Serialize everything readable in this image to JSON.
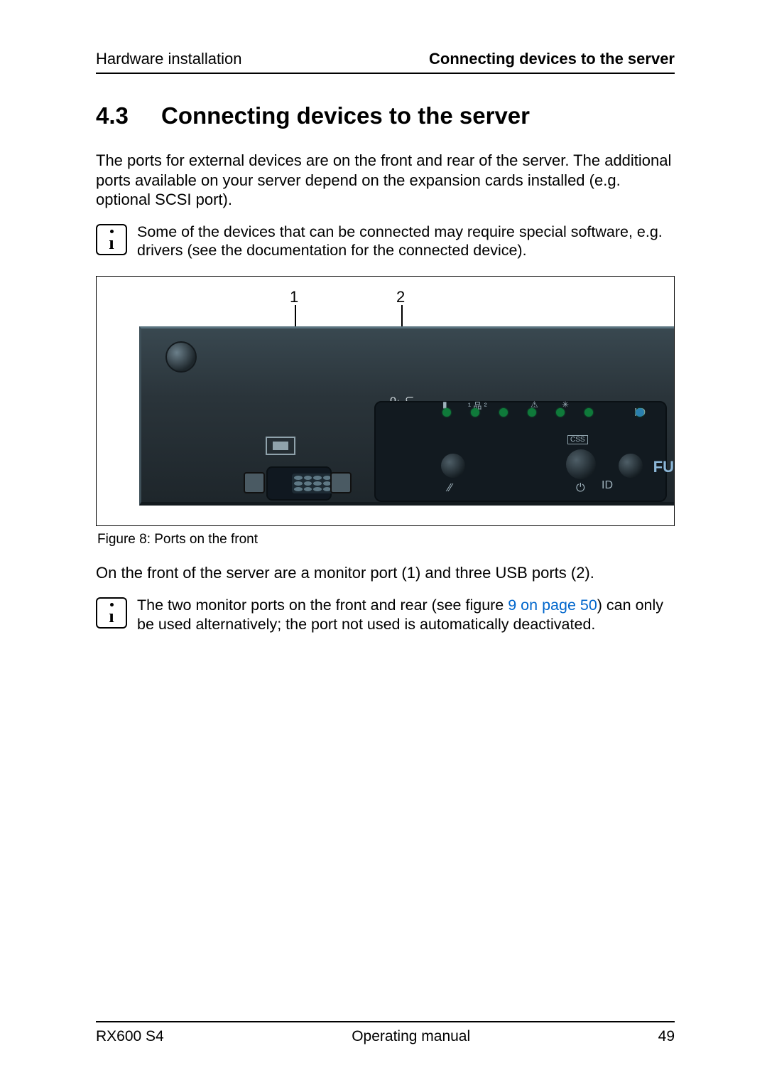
{
  "header": {
    "left": "Hardware installation",
    "right": "Connecting devices to the server"
  },
  "section": {
    "number": "4.3",
    "title": "Connecting devices to the server"
  },
  "p1": "The ports for external devices are on the front and rear of the server. The additional ports available on your server depend on the expansion cards installed (e.g. optional SCSI port).",
  "note1": "Some of the devices that can be connected may require special software, e.g. drivers (see the documentation for the connected device).",
  "fig": {
    "c1": "1",
    "c2": "2",
    "caption": "Figure 8: Ports on the front"
  },
  "p2": "On the front of the server are a monitor port (1) and three USB ports (2).",
  "note2_a": "The two monitor ports on the front and rear (see figure ",
  "note2_link": "9 on page 50",
  "note2_b": ") can only be used alternatively; the port not used is automatically deactivated.",
  "panel": {
    "id": "ID",
    "css": "CSS",
    "fu": "FU"
  },
  "footer": {
    "left": "RX600 S4",
    "center": "Operating manual",
    "right": "49"
  }
}
